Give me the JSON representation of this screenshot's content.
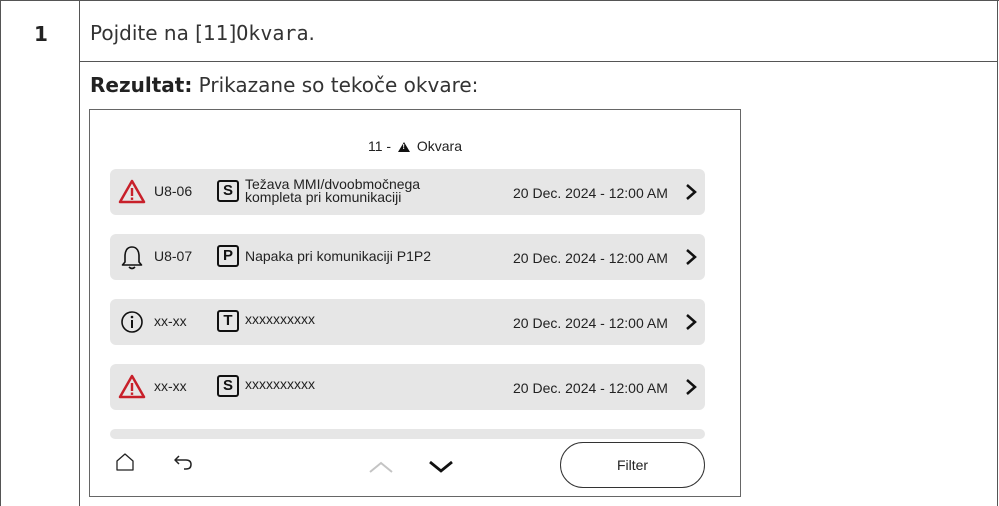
{
  "step": {
    "number": "1",
    "text_prefix": "Pojdite na [11]",
    "text_code": "Okvara",
    "text_suffix": "."
  },
  "result": {
    "label": "Rezultat:",
    "text": " Prikazane so tekoče okvare:"
  },
  "screen": {
    "title_prefix": "11 -",
    "title_icon": "warning-icon",
    "title": "Okvara",
    "rows": [
      {
        "icon": "warning-triangle-icon",
        "code": "U8-06",
        "category": "S",
        "desc_line1": "Težava MMI/dvoobmočnega",
        "desc_line2": "kompleta pri komunikaciji",
        "date": "20 Dec. 2024 - 12:00 AM"
      },
      {
        "icon": "bell-icon",
        "code": "U8-07",
        "category": "P",
        "desc_line1": "Napaka pri komunikaciji P1P2",
        "desc_line2": "",
        "date": "20 Dec. 2024 - 12:00 AM"
      },
      {
        "icon": "info-icon",
        "code": "xx-xx",
        "category": "T",
        "desc_line1": "xxxxxxxxxx",
        "desc_line2": "",
        "date": "20 Dec. 2024 - 12:00 AM"
      },
      {
        "icon": "warning-triangle-icon",
        "code": "xx-xx",
        "category": "S",
        "desc_line1": "xxxxxxxxxx",
        "desc_line2": "",
        "date": "20 Dec. 2024 - 12:00 AM"
      }
    ],
    "filter_label": "Filter",
    "colors": {
      "warning": "#c8202a",
      "row_bg": "#e6e6e6"
    }
  }
}
